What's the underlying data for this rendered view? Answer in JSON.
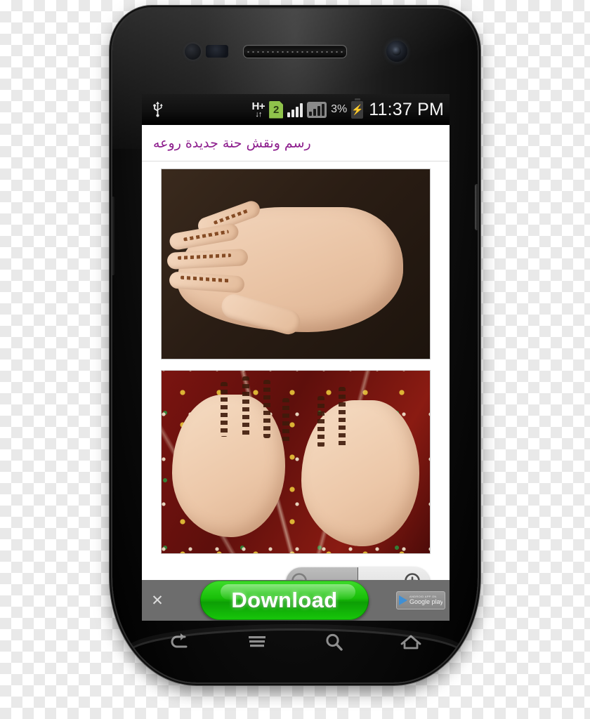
{
  "device": {
    "label": "android-smartphone",
    "hardware": {
      "earpiece": "earpiece-speaker",
      "front_camera": "front-camera",
      "proximity_sensor": "proximity-sensor",
      "volume_button": "volume-rocker",
      "power_button": "power-button"
    }
  },
  "statusbar": {
    "usb_icon": "usb-icon",
    "network_type": "H+",
    "network_arrows": "↓↑",
    "sim_badge": "2",
    "signal_icon": "signal-bars-icon",
    "signal_icon_secondary": "signal-bars-secondary-icon",
    "battery_percent": "3%",
    "battery_icon": "battery-charging-icon",
    "charging_bolt": "⚡",
    "clock": "11:37 PM"
  },
  "titlebar": {
    "title": "رسم ونقش حنة جديدة روعه",
    "title_color": "#8d1d8d"
  },
  "content": {
    "images": [
      {
        "name": "henna-hand-dark-background",
        "alt": "Hand decorated with floral henna design on dark brown background"
      },
      {
        "name": "henna-two-hands-red-fabric",
        "alt": "Two hands with intricate henna patterns over red bandhani fabric"
      }
    ]
  },
  "zoom_controls": {
    "zoom_out_icon": "zoom-out-magnifier-icon",
    "zoom_in_icon": "zoom-in-magnifier-icon",
    "zoom_out_sign": "−",
    "zoom_in_sign": "+"
  },
  "ad_banner": {
    "close_label": "✕",
    "download_label": "Download",
    "badge_line1": "ANDROID APP ON",
    "badge_line2": "Google play",
    "background_color": "#6d6d6d",
    "button_color": "#18bf08"
  },
  "navbar": {
    "buttons": [
      {
        "name": "nav-back",
        "icon": "back-arrow-icon"
      },
      {
        "name": "nav-menu",
        "icon": "menu-hamburger-icon"
      },
      {
        "name": "nav-search",
        "icon": "search-magnifier-icon"
      },
      {
        "name": "nav-home",
        "icon": "home-icon"
      }
    ]
  }
}
